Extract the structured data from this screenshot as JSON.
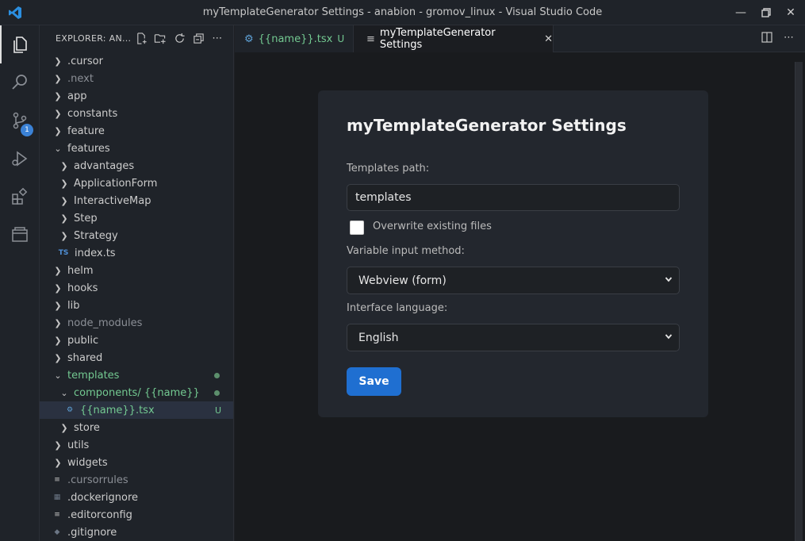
{
  "window": {
    "title": "myTemplateGenerator Settings - anabion - gromov_linux - Visual Studio Code"
  },
  "activity": {
    "scm_badge": "1"
  },
  "explorer": {
    "title": "EXPLORER: AN...",
    "items": [
      {
        "label": ".cursor",
        "kind": "folder"
      },
      {
        "label": ".next",
        "kind": "folder",
        "dim": true
      },
      {
        "label": "app",
        "kind": "folder"
      },
      {
        "label": "constants",
        "kind": "folder"
      },
      {
        "label": "feature",
        "kind": "folder"
      },
      {
        "label": "features",
        "kind": "folder-open"
      },
      {
        "label": "advantages",
        "kind": "folder"
      },
      {
        "label": "ApplicationForm",
        "kind": "folder"
      },
      {
        "label": "InteractiveMap",
        "kind": "folder"
      },
      {
        "label": "Step",
        "kind": "folder"
      },
      {
        "label": "Strategy",
        "kind": "folder"
      },
      {
        "label": "index.ts",
        "kind": "file",
        "icon": "TS"
      },
      {
        "label": "helm",
        "kind": "folder"
      },
      {
        "label": "hooks",
        "kind": "folder"
      },
      {
        "label": "lib",
        "kind": "folder"
      },
      {
        "label": "node_modules",
        "kind": "folder",
        "dim": true
      },
      {
        "label": "public",
        "kind": "folder"
      },
      {
        "label": "shared",
        "kind": "folder"
      },
      {
        "label": "templates",
        "kind": "folder-open"
      },
      {
        "label": "components",
        "kind": "folder-open",
        "suffix": " / {{name}}"
      },
      {
        "label": "{{name}}.tsx",
        "kind": "file",
        "mark": "U"
      },
      {
        "label": "store",
        "kind": "folder"
      },
      {
        "label": "utils",
        "kind": "folder"
      },
      {
        "label": "widgets",
        "kind": "folder"
      },
      {
        "label": ".cursorrules",
        "kind": "file",
        "dim": true
      },
      {
        "label": ".dockerignore",
        "kind": "file"
      },
      {
        "label": ".editorconfig",
        "kind": "file"
      },
      {
        "label": ".gitignore",
        "kind": "file"
      }
    ]
  },
  "tabs": [
    {
      "label": "{{name}}.tsx",
      "mark": "U"
    },
    {
      "label": "myTemplateGenerator Settings"
    }
  ],
  "settings": {
    "heading": "myTemplateGenerator Settings",
    "templates_path_label": "Templates path:",
    "templates_path_value": "templates",
    "overwrite_label": "Overwrite existing files",
    "overwrite_checked": false,
    "input_method_label": "Variable input method:",
    "input_method_value": "Webview (form)",
    "language_label": "Interface language:",
    "language_value": "English",
    "save_label": "Save"
  },
  "colors": {
    "accent": "#1f6fd1",
    "untracked": "#73c991"
  }
}
